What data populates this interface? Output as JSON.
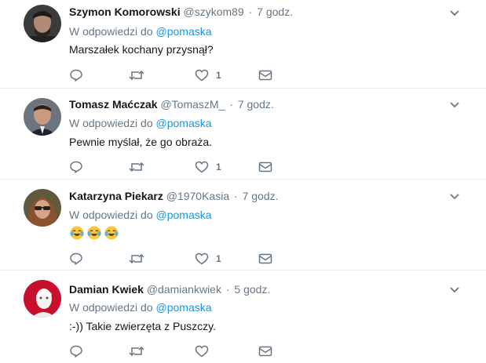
{
  "tweets": [
    {
      "name": "Szymon Komorowski",
      "handle": "@szykom89",
      "dot": "·",
      "time": "7 godz.",
      "reply_prefix": "W odpowiedzi do",
      "reply_to": "@pomaska",
      "text": "Marszałek kochany przysnął?",
      "likes": "1"
    },
    {
      "name": "Tomasz Maćczak",
      "handle": "@TomaszM_",
      "dot": "·",
      "time": "7 godz.",
      "reply_prefix": "W odpowiedzi do",
      "reply_to": "@pomaska",
      "text": "Pewnie myślał, że go obraża.",
      "likes": "1"
    },
    {
      "name": "Katarzyna Piekarz",
      "handle": "@1970Kasia",
      "dot": "·",
      "time": "7 godz.",
      "reply_prefix": "W odpowiedzi do",
      "reply_to": "@pomaska",
      "text": "😂😂😂",
      "likes": "1"
    },
    {
      "name": "Damian Kwiek",
      "handle": "@damiankwiek",
      "dot": "·",
      "time": "5 godz.",
      "reply_prefix": "W odpowiedzi do",
      "reply_to": "@pomaska",
      "text": ":-)) Takie zwierzęta z Puszczy.",
      "likes": ""
    }
  ],
  "icons": {
    "reply": "reply-icon",
    "retweet": "retweet-icon",
    "like": "heart-icon",
    "dm": "envelope-icon",
    "more": "chevron-down-icon"
  },
  "colors": {
    "mention": "#1b95e0",
    "secondary": "#657786",
    "divider": "#e6ecf0"
  }
}
